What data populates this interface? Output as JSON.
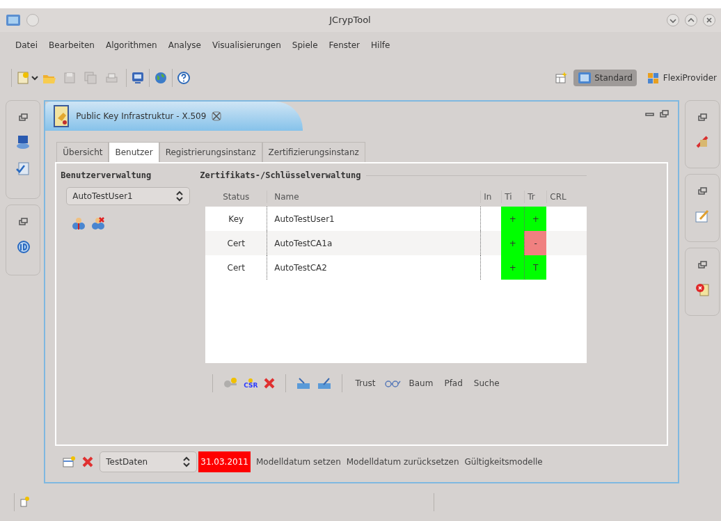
{
  "window": {
    "title": "JCrypTool"
  },
  "menu": [
    "Datei",
    "Bearbeiten",
    "Algorithmen",
    "Analyse",
    "Visualisierungen",
    "Spiele",
    "Fenster",
    "Hilfe"
  ],
  "perspectives": [
    {
      "label": "Standard",
      "selected": true
    },
    {
      "label": "FlexiProvider",
      "selected": false
    }
  ],
  "editor": {
    "title": "Public Key Infrastruktur - X.509",
    "tabs": [
      {
        "label": "Übersicht",
        "selected": false
      },
      {
        "label": "Benutzer",
        "selected": true
      },
      {
        "label": "Registrierungsinstanz",
        "selected": false
      },
      {
        "label": "Zertifizierungsinstanz",
        "selected": false
      }
    ],
    "user_panel": {
      "heading": "Benutzerverwaltung",
      "user_select": "AutoTestUser1"
    },
    "cert_panel": {
      "heading": "Zertifikats-/Schlüsselverwaltung",
      "columns": [
        "Status",
        "Name",
        "In",
        "Ti",
        "Tr",
        "CRL"
      ],
      "rows": [
        {
          "status": "Key",
          "name": "AutoTestUser1",
          "ti": {
            "text": "+",
            "color": "#00ff00"
          },
          "tr": {
            "text": "+",
            "color": "#00ff00"
          }
        },
        {
          "status": "Cert",
          "name": "AutoTestCA1a",
          "ti": {
            "text": "+",
            "color": "#00ff00"
          },
          "tr": {
            "text": "-",
            "color": "#f08080"
          }
        },
        {
          "status": "Cert",
          "name": "AutoTestCA2",
          "ti": {
            "text": "+",
            "color": "#00ff00"
          },
          "tr": {
            "text": "T",
            "color": "#00ff00"
          }
        }
      ],
      "csr_label": "CSR",
      "actions": [
        "Trust",
        "Baum",
        "Pfad",
        "Suche"
      ]
    },
    "bottom": {
      "dataset_select": "TestDaten",
      "model_date": "31.03.2011",
      "links": [
        "Modelldatum setzen",
        "Modelldatum zurücksetzen",
        "Gültigkeitsmodelle"
      ]
    }
  }
}
